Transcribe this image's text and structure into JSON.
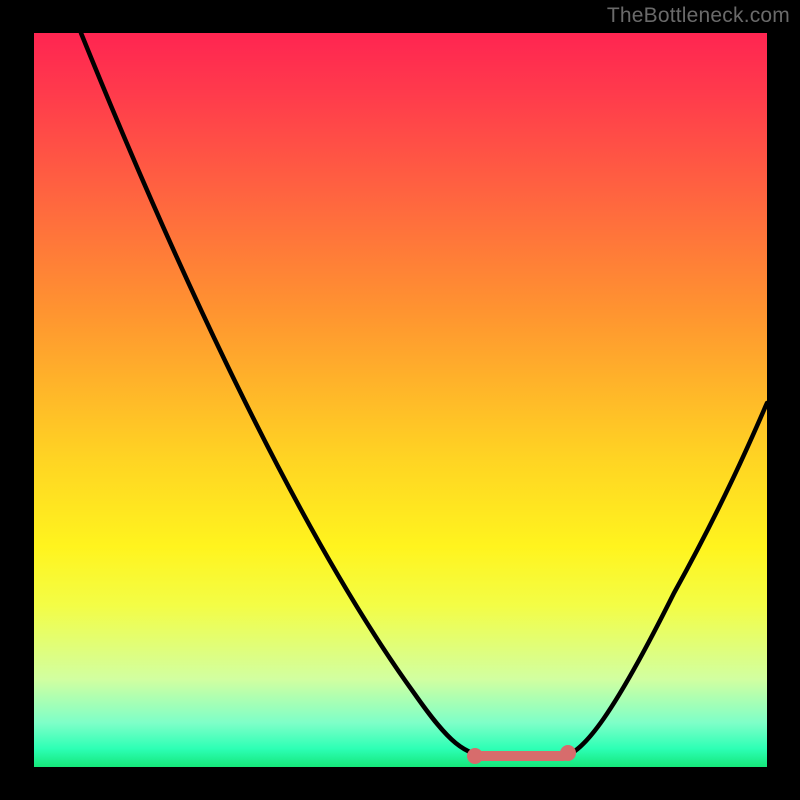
{
  "watermark": "TheBottleneck.com",
  "colors": {
    "background": "#000000",
    "curve_stroke": "#000000",
    "marker_fill": "#d76c6c",
    "gradient_top": "#ff2551",
    "gradient_bottom": "#15e77a"
  },
  "chart_data": {
    "type": "line",
    "title": "",
    "xlabel": "",
    "ylabel": "",
    "xlim": [
      0,
      100
    ],
    "ylim": [
      0,
      100
    ],
    "x": [
      0,
      5,
      10,
      15,
      20,
      25,
      30,
      35,
      40,
      45,
      50,
      55,
      58,
      61,
      64,
      67,
      70,
      72,
      75,
      80,
      85,
      90,
      95,
      100
    ],
    "values": [
      100,
      91,
      82,
      73,
      65,
      56,
      48,
      40,
      32,
      24,
      17,
      10,
      6,
      3,
      1.5,
      1,
      1,
      1.2,
      2.5,
      7,
      14,
      22,
      31,
      40
    ],
    "flat_region_x": [
      60,
      72
    ],
    "annotations": [
      {
        "type": "marker",
        "x": 60,
        "y": 2.5,
        "shape": "circle",
        "color": "#d76c6c"
      },
      {
        "type": "marker",
        "x": 72,
        "y": 2.5,
        "shape": "circle",
        "color": "#d76c6c"
      }
    ]
  }
}
